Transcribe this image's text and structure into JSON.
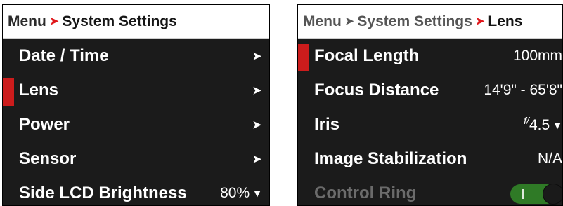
{
  "left_panel": {
    "breadcrumb": {
      "root": "Menu",
      "current": "System Settings"
    },
    "items": [
      {
        "label": "Date / Time",
        "arrow": "➤"
      },
      {
        "label": "Lens",
        "arrow": "➤"
      },
      {
        "label": "Power",
        "arrow": "➤"
      },
      {
        "label": "Sensor",
        "arrow": "➤"
      },
      {
        "label": "Side LCD Brightness",
        "value": "80%",
        "caret": "▼"
      }
    ],
    "selected_item": "Lens"
  },
  "right_panel": {
    "breadcrumb": {
      "root": "Menu",
      "middle": "System Settings",
      "current": "Lens"
    },
    "items": [
      {
        "label": "Focal Length",
        "value": "100mm"
      },
      {
        "label": "Focus Distance",
        "value": "14'9\" - 65'8\""
      },
      {
        "label": "Iris",
        "value_prefix": "f/",
        "value": "4.5",
        "caret": "▼"
      },
      {
        "label": "Image Stabilization",
        "value": "N/A"
      },
      {
        "label": "Control Ring",
        "toggle_state": "on",
        "enabled": false
      }
    ],
    "selected_item": "Focal Length"
  },
  "colors": {
    "accent_red": "#cc1c1c",
    "panel_bg": "#1b1b1b",
    "toggle_green": "#2f7a26"
  }
}
